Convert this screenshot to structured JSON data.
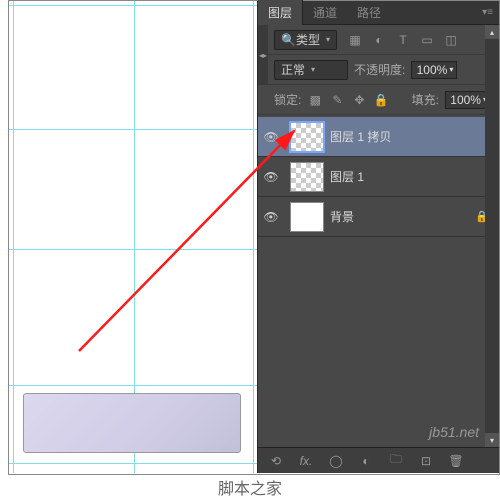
{
  "tabs": {
    "layers": "图层",
    "channels": "通道",
    "paths": "路径"
  },
  "filter": {
    "label": "类型",
    "search_icon": "🔍"
  },
  "type_icons": [
    "image",
    "adjust",
    "text",
    "shape",
    "smart"
  ],
  "blend": {
    "mode": "正常",
    "opacity_label": "不透明度:",
    "opacity_value": "100%"
  },
  "lock": {
    "label": "锁定:",
    "fill_label": "填充:",
    "fill_value": "100%"
  },
  "layers_list": [
    {
      "name": "图层 1 拷贝",
      "selected": true,
      "thumb": "chk"
    },
    {
      "name": "图层 1",
      "selected": false,
      "thumb": "chk"
    },
    {
      "name": "背景",
      "selected": false,
      "thumb": "bg",
      "locked": true
    }
  ],
  "bottom_icons": [
    "link",
    "fx",
    "mask",
    "adjust",
    "group",
    "new",
    "trash"
  ],
  "caption": "脚本之家",
  "watermark": "jb51.net"
}
